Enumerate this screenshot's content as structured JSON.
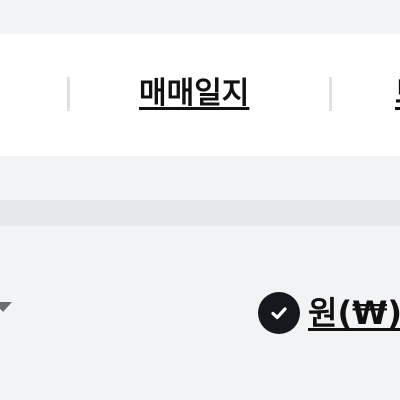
{
  "tabs": {
    "active_label": "매매일지",
    "next_label": "보"
  },
  "currency": {
    "label": "원(₩)",
    "selected": true
  },
  "colors": {
    "page_bg": "#f2f3f5",
    "panel_bg": "#ffffff",
    "text": "#111111",
    "check_bg": "#15181d"
  },
  "icons": {
    "selected": "check-circle-icon",
    "dropdown": "caret-down-icon"
  }
}
